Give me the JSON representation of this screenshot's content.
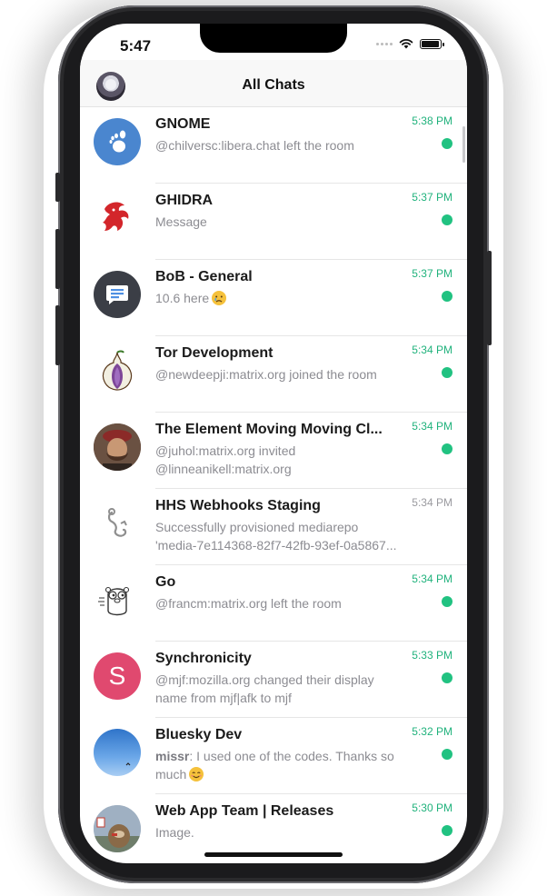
{
  "status_bar": {
    "time": "5:47"
  },
  "header": {
    "title": "All Chats"
  },
  "rooms": [
    {
      "name": "GNOME",
      "message": "@chilversc:libera.chat left the room",
      "time": "5:38 PM",
      "unread": true,
      "avatar": "gnome-foot-icon",
      "avatar_color": "#4a86cf"
    },
    {
      "name": "GHIDRA",
      "message": "Message",
      "time": "5:37 PM",
      "unread": true,
      "avatar": "ghidra-dragon-icon",
      "avatar_color": "#d3262b"
    },
    {
      "name": "BoB - General",
      "message": "10.6 here",
      "message_emoji": "crying-face-emoji",
      "time": "5:37 PM",
      "unread": true,
      "avatar": "chat-bubble-icon",
      "avatar_color": "#3b3e46"
    },
    {
      "name": "Tor Development",
      "message": "@newdeepji:matrix.org joined the room",
      "time": "5:34 PM",
      "unread": true,
      "avatar": "tor-onion-icon",
      "avatar_color": "#7d4698"
    },
    {
      "name": "The Element Moving Moving Cl...",
      "message": "@juhol:matrix.org invited @linneanikell:matrix.org",
      "time": "5:34 PM",
      "unread": true,
      "avatar": "person-photo",
      "avatar_color": "#6b4a3a"
    },
    {
      "name": "HHS Webhooks Staging",
      "message": "Successfully provisioned mediarepo 'media-7e114368-82f7-42fb-93ef-0a5867...",
      "time": "5:34 PM",
      "unread": false,
      "avatar": "hook-icon",
      "avatar_color": "#9a9a9a"
    },
    {
      "name": "Go",
      "message": "@francm:matrix.org left the room",
      "time": "5:34 PM",
      "unread": true,
      "avatar": "gopher-icon",
      "avatar_color": "#444444"
    },
    {
      "name": "Synchronicity",
      "message": "@mjf:mozilla.org changed their display name from mjf|afk to mjf",
      "time": "5:33 PM",
      "unread": true,
      "avatar_letter": "S",
      "avatar_color": "#e0496f"
    },
    {
      "name": "Bluesky Dev",
      "message_sender": "missr",
      "message": ": I used one of the codes. Thanks so much",
      "message_emoji": "smiling-face-emoji",
      "time": "5:32 PM",
      "unread": true,
      "avatar": "blue-sky-photo",
      "avatar_color": "#3e86d8"
    },
    {
      "name": "Web App Team | Releases",
      "message": "Image.",
      "time": "5:30 PM",
      "unread": true,
      "avatar": "beaver-photo",
      "avatar_color": "#a8b3c0"
    }
  ]
}
